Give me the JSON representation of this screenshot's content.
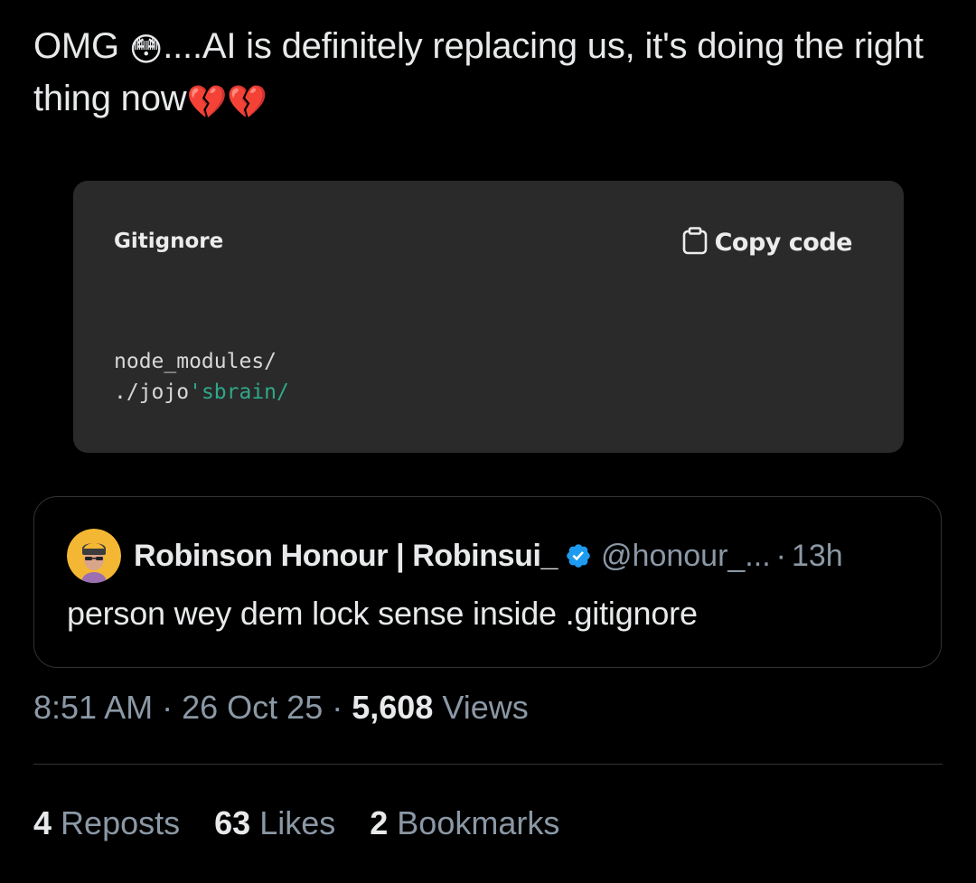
{
  "tweet": {
    "text_part1": "OMG ",
    "emoji_flushed": "😳",
    "text_part2": "....AI is definitely replacing us, it's doing the right thing now",
    "emoji_broken_heart": "💔"
  },
  "code_block": {
    "language": "Gitignore",
    "copy_label": "Copy code",
    "line1": "node_modules/",
    "line2_plain": "./jojo",
    "line2_string": "'sbrain/"
  },
  "quote": {
    "author_name": "Robinson Honour | Robinsui_",
    "handle": "@honour_...",
    "separator": "·",
    "time": "13h",
    "text": "person wey dem lock sense inside .gitignore"
  },
  "meta": {
    "time": "8:51 AM",
    "separator": "·",
    "date": "26 Oct 25",
    "views_count": "5,608",
    "views_label": "Views"
  },
  "stats": {
    "reposts_count": "4",
    "reposts_label": "Reposts",
    "likes_count": "63",
    "likes_label": "Likes",
    "bookmarks_count": "2",
    "bookmarks_label": "Bookmarks"
  },
  "colors": {
    "background": "#000000",
    "text": "#e7e9ea",
    "muted": "#8b98a5",
    "code_bg": "#2a2a2a",
    "code_string": "#2fa889",
    "verified_blue": "#1d9bf0",
    "border": "#2f3336"
  },
  "icons": {
    "copy": "clipboard-icon",
    "verified": "verified-badge-icon"
  }
}
